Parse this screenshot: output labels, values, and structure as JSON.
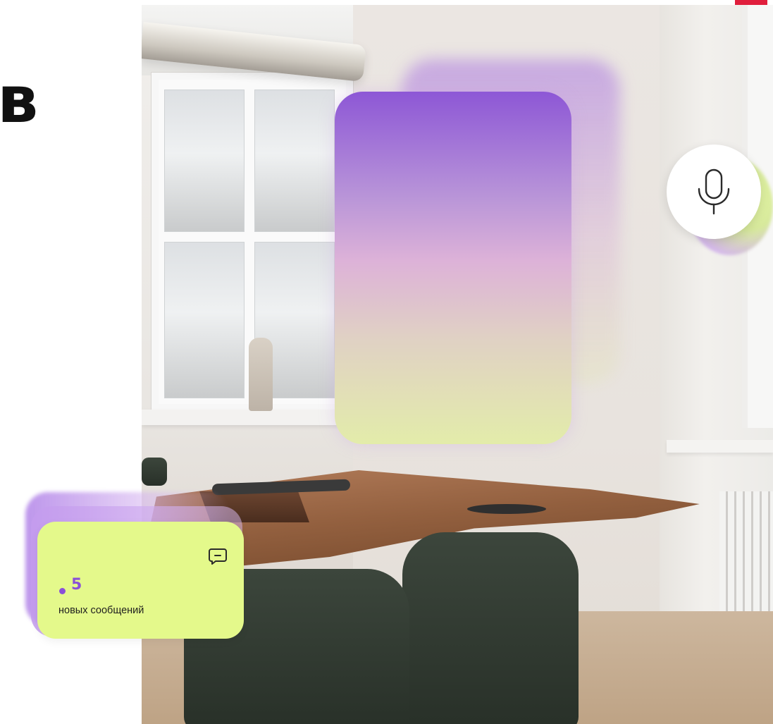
{
  "heading": {
    "visible_fragment": "в"
  },
  "voice_button": {
    "icon": "microphone-icon"
  },
  "notification_card": {
    "icon": "chat-bubble-icon",
    "count": "5",
    "label": "новых сообщений"
  },
  "colors": {
    "accent_red": "#e01e3c",
    "card_lime": "#e4f98b",
    "accent_purple": "#8a50d8",
    "gradient_top": "#8d57d6",
    "gradient_mid": "#ddb2d8",
    "gradient_bottom": "#e3ecaa"
  }
}
